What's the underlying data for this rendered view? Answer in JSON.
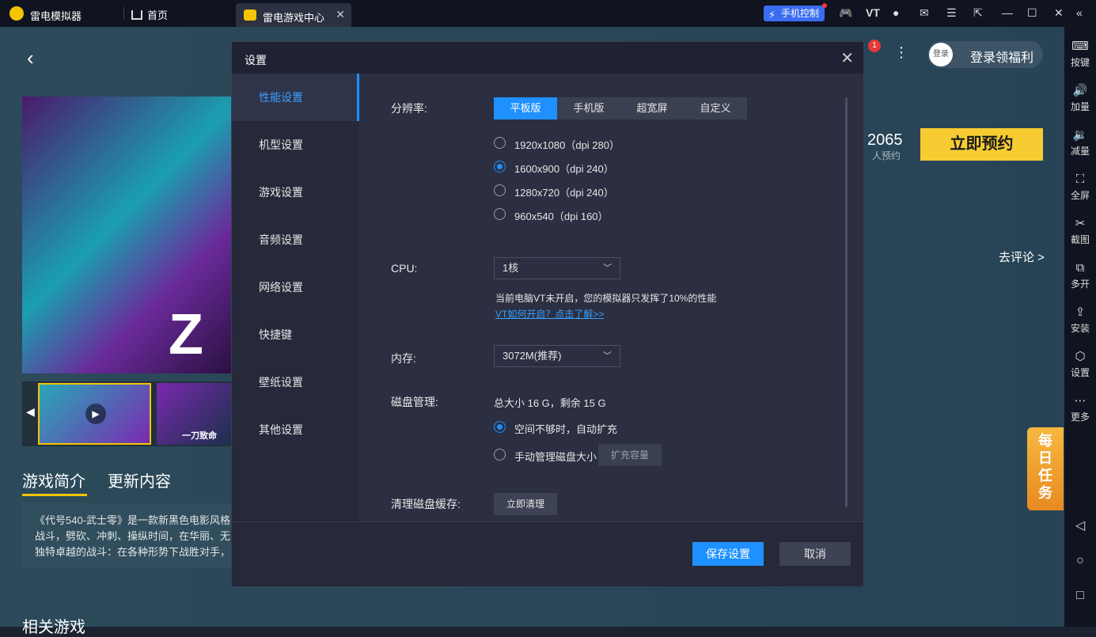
{
  "titlebar": {
    "app_name": "雷电模拟器",
    "tabs": [
      {
        "label": "首页"
      },
      {
        "label": "雷电游戏中心"
      }
    ],
    "phone_control": "手机控制",
    "vt_label": "VT"
  },
  "page": {
    "count": "2065",
    "count_sub": "人预约",
    "reserve_button": "立即预约",
    "comment_link": "去评论 >",
    "login_avatar": "登录",
    "login_label": "登录领福利",
    "badge": "1",
    "hero_text": "Z",
    "section_tabs": [
      "游戏简介",
      "更新内容"
    ],
    "description_lines": [
      "《代号540-武士零》是一款新黑色电影风格",
      "战斗，劈砍、冲刺、操纵时间，在华丽、无",
      "独特卓越的战斗：在各种形势下战胜对手，"
    ],
    "related": "相关游戏",
    "daily_task": "每日任务",
    "thumb2_caption": "一刀致命"
  },
  "sidebar": {
    "items": [
      {
        "icon": "keyboard-icon",
        "label": "按键"
      },
      {
        "icon": "volume-up-icon",
        "label": "加量"
      },
      {
        "icon": "volume-down-icon",
        "label": "减量"
      },
      {
        "icon": "fullscreen-icon",
        "label": "全屏"
      },
      {
        "icon": "scissors-icon",
        "label": "截图"
      },
      {
        "icon": "multi-open-icon",
        "label": "多开"
      },
      {
        "icon": "apk-install-icon",
        "label": "安装"
      },
      {
        "icon": "settings-icon",
        "label": "设置"
      },
      {
        "icon": "more-icon",
        "label": "更多"
      }
    ]
  },
  "dialog": {
    "title": "设置",
    "menu": [
      {
        "label": "性能设置",
        "active": true
      },
      {
        "label": "机型设置"
      },
      {
        "label": "游戏设置"
      },
      {
        "label": "音频设置"
      },
      {
        "label": "网络设置"
      },
      {
        "label": "快捷键"
      },
      {
        "label": "壁纸设置"
      },
      {
        "label": "其他设置"
      }
    ],
    "resolution": {
      "label": "分辨率:",
      "modes": [
        "平板版",
        "手机版",
        "超宽屏",
        "自定义"
      ],
      "selected_mode": "平板版",
      "options": [
        "1920x1080（dpi 280）",
        "1600x900（dpi 240）",
        "1280x720（dpi 240）",
        "960x540（dpi 160）"
      ],
      "selected_option": "1600x900（dpi 240）"
    },
    "cpu": {
      "label": "CPU:",
      "value": "1核",
      "note": "当前电脑VT未开启，您的模拟器只发挥了10%的性能",
      "link": "VT如何开启？点击了解>>"
    },
    "memory": {
      "label": "内存:",
      "value": "3072M(推荐)"
    },
    "disk": {
      "label": "磁盘管理:",
      "summary": "总大小 16 G，剩余 15 G",
      "options": [
        "空间不够时，自动扩充",
        "手动管理磁盘大小"
      ],
      "selected_option": "空间不够时，自动扩充",
      "expand_button": "扩充容量"
    },
    "cache": {
      "label": "清理磁盘缓存:",
      "button": "立即清理"
    },
    "save_button": "保存设置",
    "cancel_button": "取消"
  }
}
